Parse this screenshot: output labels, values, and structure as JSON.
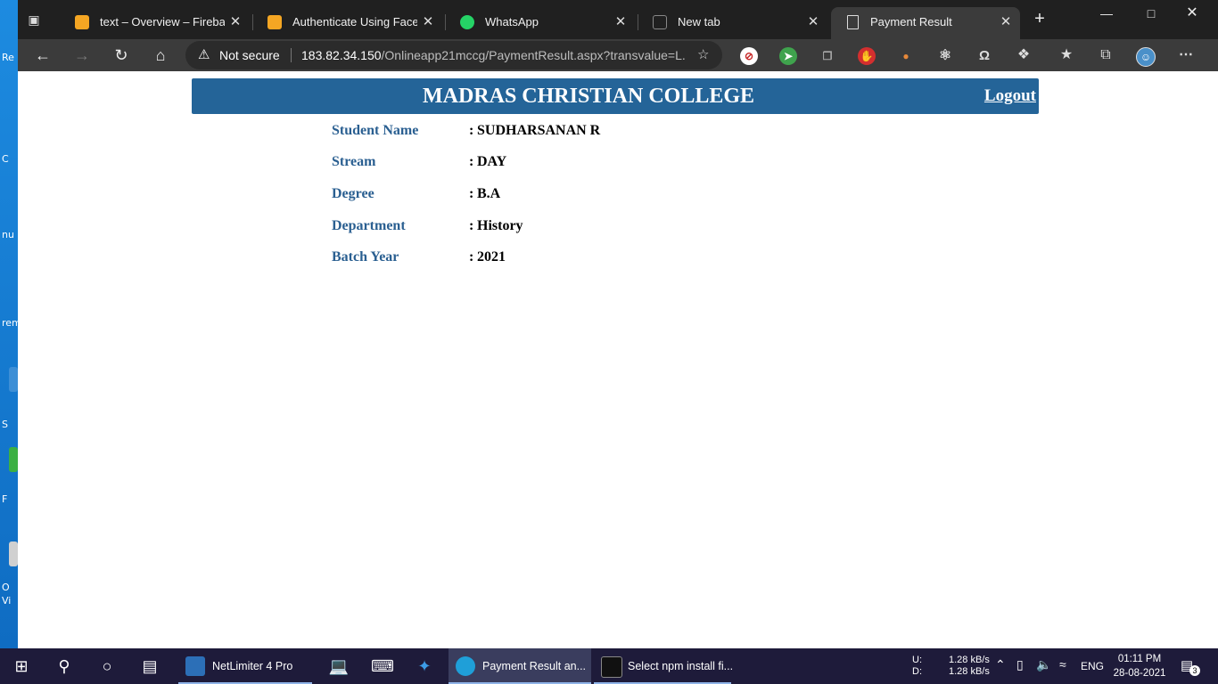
{
  "desktop": {
    "labels": [
      "Re",
      "C",
      "nu",
      "rem",
      "S",
      "F",
      "O",
      "Vi"
    ]
  },
  "browser": {
    "tabs": [
      {
        "label": "text – Overview – Firebase co",
        "icon": "firebase-icon",
        "color": "#f5a623"
      },
      {
        "label": "Authenticate Using Faceboo",
        "icon": "firebase-icon",
        "color": "#f5a623"
      },
      {
        "label": "WhatsApp",
        "icon": "whatsapp-icon",
        "color": "#25d366"
      },
      {
        "label": "New tab",
        "icon": "newtab-icon",
        "color": "#555555"
      },
      {
        "label": "Payment Result",
        "icon": "page-icon",
        "color": "#ffffff"
      }
    ],
    "address": {
      "security": "Not secure",
      "host": "183.82.34.150",
      "path": "/Onlineapp21mccg/PaymentResult.aspx?transvalue=L..."
    }
  },
  "page": {
    "college": "MADRAS CHRISTIAN COLLEGE",
    "logout": "Logout",
    "details": [
      {
        "label": "Student Name",
        "value": "SUDHARSANAN R"
      },
      {
        "label": "Stream",
        "value": "DAY"
      },
      {
        "label": "Degree",
        "value": "B.A"
      },
      {
        "label": "Department",
        "value": "History"
      },
      {
        "label": "Batch Year",
        "value": "2021"
      }
    ],
    "separator": ":"
  },
  "taskbar": {
    "apps": [
      {
        "label": "NetLimiter 4 Pro"
      },
      {
        "label": "Payment Result an..."
      },
      {
        "label": "Select npm install fi..."
      }
    ],
    "net": {
      "up_label": "U:",
      "down_label": "D:",
      "up": "1.28 kB/s",
      "down": "1.28 kB/s"
    },
    "lang": "ENG",
    "time": "01:11 PM",
    "date": "28-08-2021",
    "notifications": "3"
  },
  "colors": {
    "header": "#246498",
    "label": "#2a5f91"
  }
}
